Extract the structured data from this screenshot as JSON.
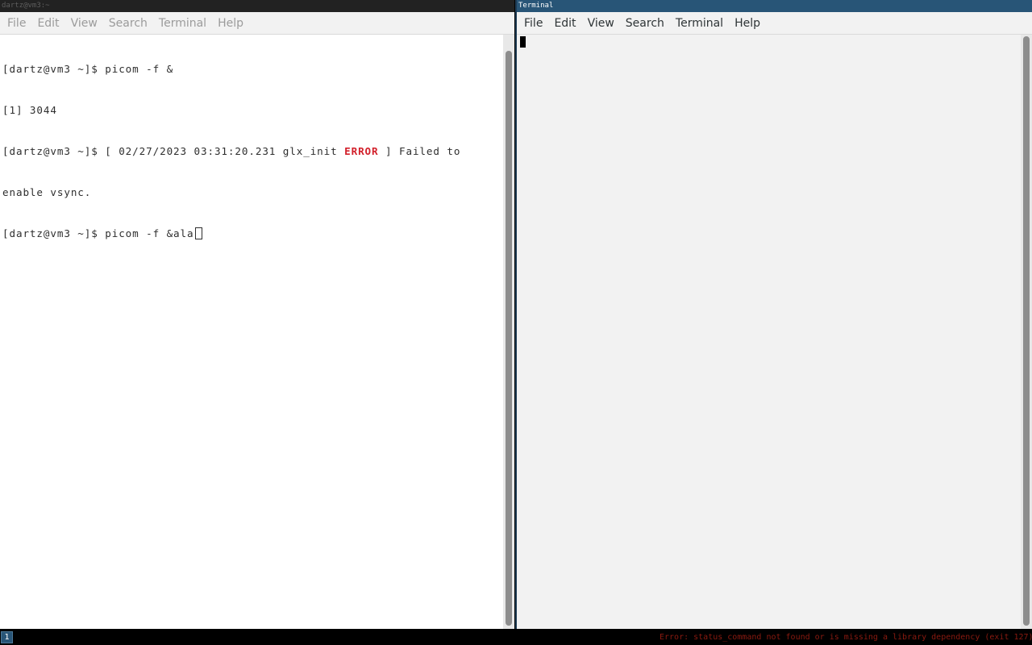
{
  "windows": {
    "left": {
      "title": "dartz@vm3:~",
      "menu": [
        "File",
        "Edit",
        "View",
        "Search",
        "Terminal",
        "Help"
      ],
      "terminal": {
        "line1": "[dartz@vm3 ~]$ picom -f &",
        "line2": "[1] 3044",
        "line3_pre": "[dartz@vm3 ~]$ [ 02/27/2023 03:31:20.231 glx_init ",
        "line3_err": "ERROR",
        "line3_post": " ] Failed to",
        "line4": "enable vsync.",
        "line5": "[dartz@vm3 ~]$ picom -f &ala"
      }
    },
    "right": {
      "title": "Terminal",
      "menu": [
        "File",
        "Edit",
        "View",
        "Search",
        "Terminal",
        "Help"
      ]
    }
  },
  "statusbar": {
    "workspace": "1",
    "error": "Error: status_command not found or is missing a library dependency (exit 127)"
  },
  "colors": {
    "focused_title": "#285577",
    "unfocused_title": "#222222",
    "error_red": "#d21f2a"
  }
}
